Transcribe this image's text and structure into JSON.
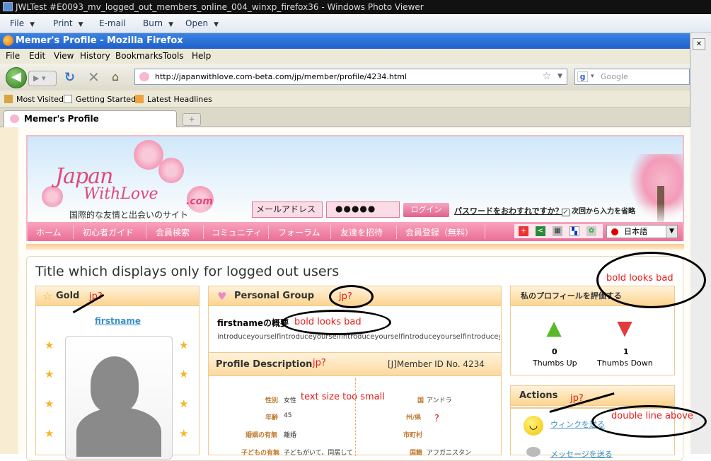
{
  "photo_viewer": {
    "title": "JWLTest #E0093_mv_logged_out_members_online_004_winxp_firefox36 - Windows Photo Viewer",
    "menu": [
      "File",
      "Print",
      "E-mail",
      "Burn",
      "Open"
    ]
  },
  "firefox": {
    "title": "Memer's Profile - Mozilla Firefox",
    "menu": [
      "File",
      "Edit",
      "View",
      "History",
      "Bookmarks",
      "Tools",
      "Help"
    ],
    "url": "http://japanwithlove.com-beta.com/jp/member/profile/4234.html",
    "search_placeholder": "Google",
    "bookmarks": [
      "Most Visited",
      "Getting Started",
      "Latest Headlines"
    ],
    "tab_label": "Memer's Profile",
    "new_tab": "+"
  },
  "site": {
    "logo_line1": "Japan",
    "logo_line2": "WithLove",
    "logo_com": ".com",
    "tagline": "国際的な友情と出会いのサイト",
    "email_placeholder": "メールアドレス",
    "password_mask": "●●●●●",
    "login_label": "ログイン",
    "forgot_password": "パスワードをおわすれですか？",
    "remember_me": "次回から入力を省略",
    "nav": [
      "ホーム",
      "初心者ガイド",
      "会員検索",
      "コミュニティ",
      "フォーラム",
      "友達を招待",
      "会員登録（無料）"
    ],
    "language": "日本語"
  },
  "page": {
    "title": "Title which displays only for logged out users",
    "gold_panel": {
      "heading": "Gold",
      "username": "firstname"
    },
    "personal_panel": {
      "heading": "Personal Group",
      "overview_title": "firstnameの概要",
      "intro": "introduceyourselfintroduceyourselfintroduceyourselfintroduceyourselfintroduceyourselfi",
      "description_heading": "Profile Description",
      "member_id": "[J]Member ID No. 4234",
      "fields": [
        {
          "label": "性別",
          "value": "女性"
        },
        {
          "label": "年齢",
          "value": "45"
        },
        {
          "label": "婚姻の有無",
          "value": "離婚"
        },
        {
          "label": "子どもの有無",
          "value": "子どもがいて、同居して"
        }
      ],
      "fields_right": [
        {
          "label": "国",
          "value": "アンドラ"
        },
        {
          "label": "州/県",
          "value": ""
        },
        {
          "label": "市町村",
          "value": ""
        },
        {
          "label": "国籍",
          "value": "アフガニスタン"
        }
      ]
    },
    "rate_panel": {
      "heading": "私のプロフィールを評価する",
      "thumbs_up_count": "0",
      "thumbs_up_label": "Thumbs Up",
      "thumbs_down_count": "1",
      "thumbs_down_label": "Thumbs Down"
    },
    "actions_panel": {
      "heading": "Actions",
      "wink": "ウィンクを送る",
      "second": "メッセージを送る"
    }
  },
  "annotations": {
    "gold_jp": "jp?",
    "personal_jp": "jp?",
    "bold_title": "bold looks bad",
    "bold_overview": "bold looks bad",
    "desc_jp": "jp?",
    "text_small": "text size too small",
    "question": "?",
    "actions_jp": "jp?",
    "double_line": "double line above"
  }
}
